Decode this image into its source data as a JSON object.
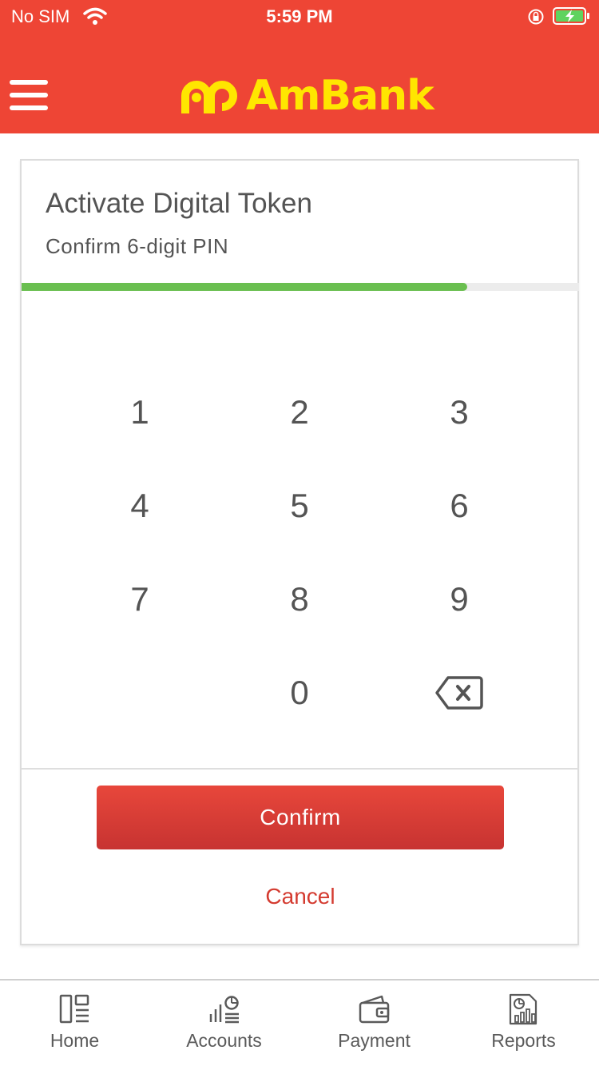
{
  "status_bar": {
    "carrier": "No SIM",
    "time": "5:59 PM"
  },
  "header": {
    "brand": "AmBank",
    "icons": [
      "menu-icon",
      "ambank-logo"
    ]
  },
  "colors": {
    "header_bg": "#ee4535",
    "brand_yellow": "#ffe600",
    "progress_green": "#6abf50",
    "confirm_bg": "#d63c34",
    "cancel_text": "#d43b30"
  },
  "card": {
    "title": "Activate Digital Token",
    "subtitle": "Confirm 6-digit PIN",
    "progress": 0.8
  },
  "keypad": {
    "keys": [
      "1",
      "2",
      "3",
      "4",
      "5",
      "6",
      "7",
      "8",
      "9",
      "0"
    ],
    "backspace_icon": "backspace-icon"
  },
  "actions": {
    "confirm_label": "Confirm",
    "cancel_label": "Cancel"
  },
  "tabbar": {
    "tabs": [
      {
        "label": "Home",
        "icon": "home-icon"
      },
      {
        "label": "Accounts",
        "icon": "accounts-icon"
      },
      {
        "label": "Payment",
        "icon": "wallet-icon"
      },
      {
        "label": "Reports",
        "icon": "reports-icon"
      }
    ]
  }
}
